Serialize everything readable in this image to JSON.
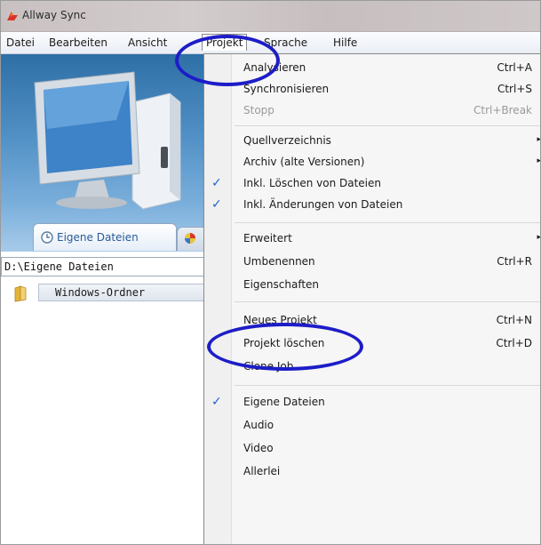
{
  "window": {
    "title": "Allway Sync"
  },
  "menubar": {
    "items": [
      {
        "label": "Datei"
      },
      {
        "label": "Bearbeiten"
      },
      {
        "label": "Ansicht"
      },
      {
        "label": "Projekt"
      },
      {
        "label": "Sprache"
      },
      {
        "label": "Hilfe"
      }
    ],
    "active_index": 3
  },
  "left_panel": {
    "tab_label": "Eigene Dateien",
    "path_value": "D:\\Eigene Dateien",
    "folder_label": "Windows-Ordner"
  },
  "project_menu": {
    "items": [
      {
        "label": "Analysieren",
        "shortcut": "Ctrl+A",
        "checked": false,
        "disabled": false,
        "submenu": false
      },
      {
        "label": "Synchronisieren",
        "shortcut": "Ctrl+S",
        "checked": false,
        "disabled": false,
        "submenu": false
      },
      {
        "label": "Stopp",
        "shortcut": "Ctrl+Break",
        "checked": false,
        "disabled": true,
        "submenu": false
      },
      {
        "label": "Quellverzeichnis",
        "shortcut": "",
        "checked": false,
        "disabled": false,
        "submenu": true
      },
      {
        "label": "Archiv (alte Versionen)",
        "shortcut": "",
        "checked": false,
        "disabled": false,
        "submenu": true
      },
      {
        "label": "Inkl. Löschen von Dateien",
        "shortcut": "",
        "checked": true,
        "disabled": false,
        "submenu": false
      },
      {
        "label": "Inkl. Änderungen von Dateien",
        "shortcut": "",
        "checked": true,
        "disabled": false,
        "submenu": false
      },
      {
        "label": "Erweitert",
        "shortcut": "",
        "checked": false,
        "disabled": false,
        "submenu": true
      },
      {
        "label": "Umbenennen",
        "shortcut": "Ctrl+R",
        "checked": false,
        "disabled": false,
        "submenu": false
      },
      {
        "label": "Eigenschaften",
        "shortcut": "",
        "checked": false,
        "disabled": false,
        "submenu": false
      },
      {
        "label": "Neues Projekt",
        "shortcut": "Ctrl+N",
        "checked": false,
        "disabled": false,
        "submenu": false
      },
      {
        "label": "Projekt löschen",
        "shortcut": "Ctrl+D",
        "checked": false,
        "disabled": false,
        "submenu": false
      },
      {
        "label": "Clone Job",
        "shortcut": "",
        "checked": false,
        "disabled": false,
        "submenu": false
      },
      {
        "label": "Eigene Dateien",
        "shortcut": "",
        "checked": true,
        "disabled": false,
        "submenu": false
      },
      {
        "label": "Audio",
        "shortcut": "",
        "checked": false,
        "disabled": false,
        "submenu": false
      },
      {
        "label": "Video",
        "shortcut": "",
        "checked": false,
        "disabled": false,
        "submenu": false
      },
      {
        "label": "Allerlei",
        "shortcut": "",
        "checked": false,
        "disabled": false,
        "submenu": false
      }
    ],
    "check_glyph": "✓",
    "submenu_glyph": "▸"
  },
  "colors": {
    "annotation": "#1d1dc8",
    "check": "#1f5fc8",
    "tab_text": "#2a5a9a"
  }
}
